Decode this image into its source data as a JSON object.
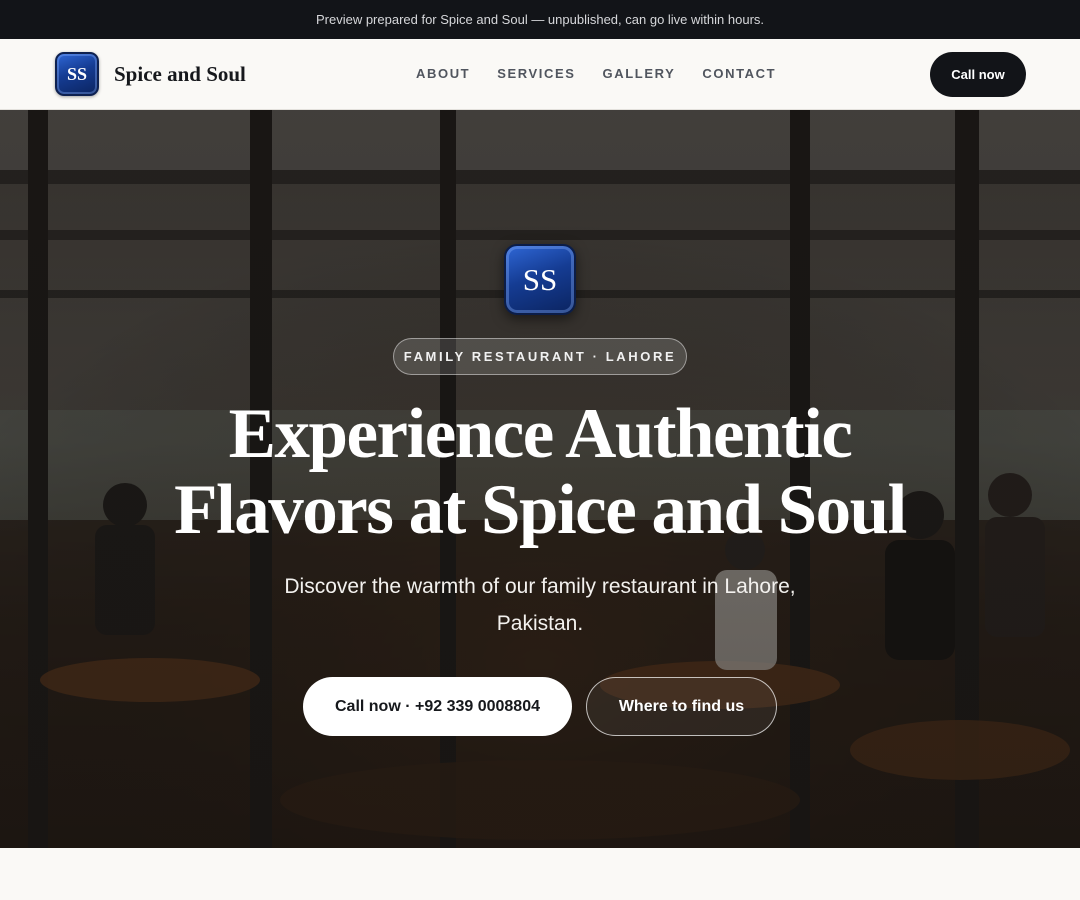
{
  "announcement": "Preview prepared for Spice and Soul — unpublished, can go live within hours.",
  "header": {
    "logo_text": "SS",
    "brand_name": "Spice and Soul",
    "nav": [
      "ABOUT",
      "SERVICES",
      "GALLERY",
      "CONTACT"
    ],
    "cta_label": "Call now"
  },
  "hero": {
    "logo_text": "SS",
    "tagline": "FAMILY RESTAURANT · LAHORE",
    "headline_line1": "Experience Authentic",
    "headline_line2": "Flavors at Spice and Soul",
    "subtitle_line1": "Discover the warmth of our family restaurant in Lahore,",
    "subtitle_line2": "Pakistan.",
    "primary_cta": "Call now · +92 339 0008804",
    "secondary_cta": "Where to find us",
    "background_image": "restaurant-interior-photo"
  },
  "colors": {
    "dark": "#121418",
    "logo_blue": "#153c93",
    "page_bg": "#faf9f6"
  }
}
